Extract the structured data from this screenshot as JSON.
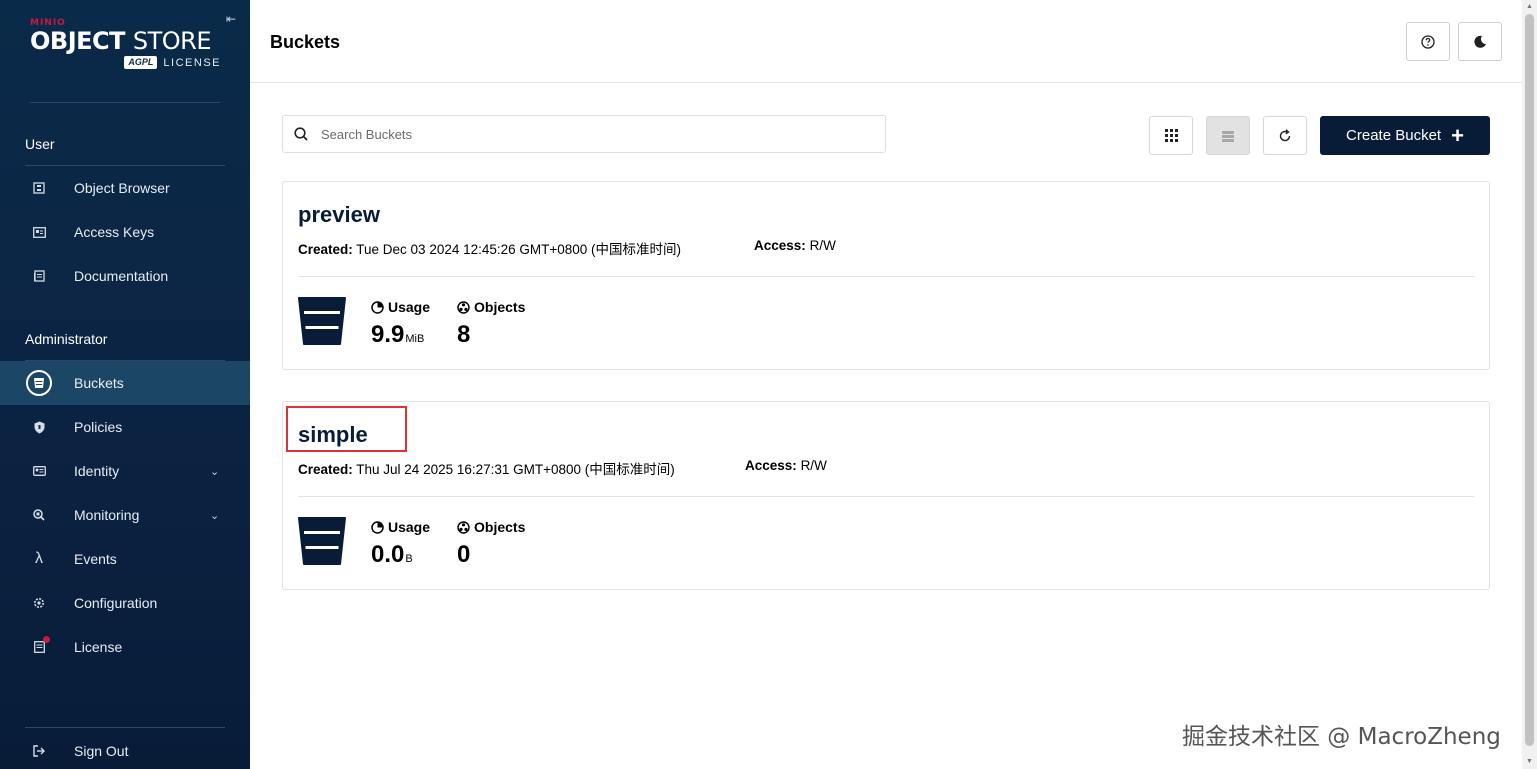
{
  "logo": {
    "brand": "MINIO",
    "product_bold": "OBJECT",
    "product_thin": "STORE",
    "agpl": "AGPL",
    "license": "LICENSE"
  },
  "sidebar": {
    "user_section": "User",
    "user_items": [
      {
        "label": "Object Browser",
        "icon": "object-browser-icon"
      },
      {
        "label": "Access Keys",
        "icon": "access-keys-icon"
      },
      {
        "label": "Documentation",
        "icon": "documentation-icon"
      }
    ],
    "admin_section": "Administrator",
    "admin_items": [
      {
        "label": "Buckets",
        "icon": "bucket-icon",
        "active": true
      },
      {
        "label": "Policies",
        "icon": "shield-icon"
      },
      {
        "label": "Identity",
        "icon": "identity-icon",
        "expandable": true
      },
      {
        "label": "Monitoring",
        "icon": "monitoring-icon",
        "expandable": true
      },
      {
        "label": "Events",
        "icon": "lambda-icon"
      },
      {
        "label": "Configuration",
        "icon": "gear-icon"
      },
      {
        "label": "License",
        "icon": "license-icon",
        "badge": true
      }
    ],
    "sign_out": "Sign Out",
    "lambda_glyph": "λ"
  },
  "header": {
    "title": "Buckets"
  },
  "search": {
    "placeholder": "Search Buckets",
    "value": ""
  },
  "toolbar": {
    "create_label": "Create Bucket",
    "create_plus": "+"
  },
  "buckets": [
    {
      "name": "preview",
      "created_label": "Created:",
      "created": "Tue Dec 03 2024 12:45:26 GMT+0800 (中国标准时间)",
      "access_label": "Access:",
      "access": "R/W",
      "usage_label": "Usage",
      "usage_value": "9.9",
      "usage_unit": "MiB",
      "objects_label": "Objects",
      "objects_value": "8"
    },
    {
      "name": "simple",
      "created_label": "Created:",
      "created": "Thu Jul 24 2025 16:27:31 GMT+0800 (中国标准时间)",
      "access_label": "Access:",
      "access": "R/W",
      "usage_label": "Usage",
      "usage_value": "0.0",
      "usage_unit": "B",
      "objects_label": "Objects",
      "objects_value": "0"
    }
  ],
  "watermark": "掘金技术社区 @ MacroZheng",
  "colors": {
    "sidebar_bg": "#0a2a49",
    "active_bg": "#1c4666",
    "primary": "#081c38",
    "brand_red": "#c51b3d",
    "highlight": "#d9343b"
  }
}
